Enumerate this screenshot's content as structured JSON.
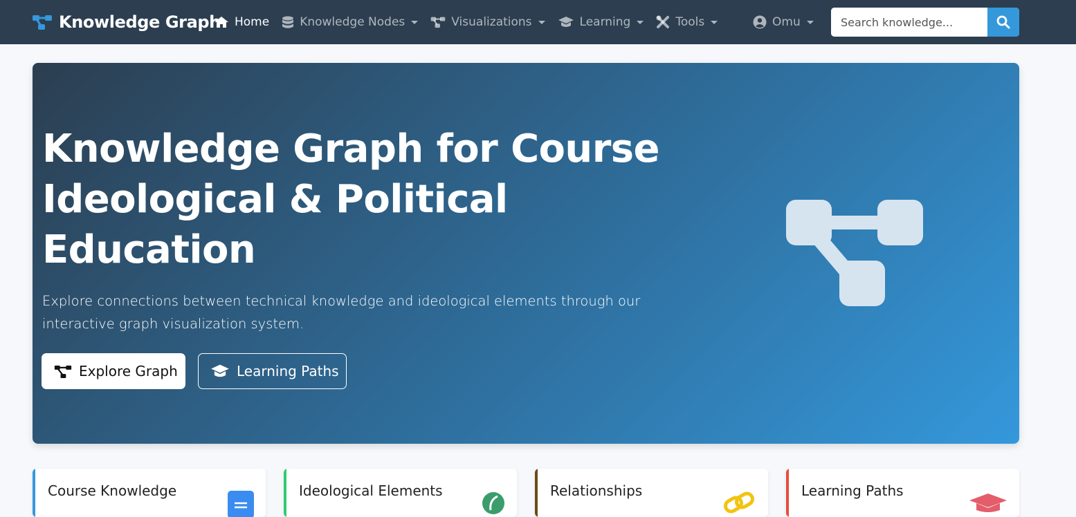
{
  "navbar": {
    "brand": "Knowledge Graph",
    "items": [
      {
        "label": "Home",
        "icon": "home-icon",
        "active": true
      },
      {
        "label": "Knowledge Nodes",
        "icon": "database-icon",
        "dropdown": true
      },
      {
        "label": "Visualizations",
        "icon": "project-diagram-icon",
        "dropdown": true
      },
      {
        "label": "Learning",
        "icon": "graduation-cap-icon",
        "dropdown": true
      },
      {
        "label": "Tools",
        "icon": "tools-icon",
        "dropdown": true
      }
    ],
    "user": "Omu",
    "search_placeholder": "Search knowledge..."
  },
  "hero": {
    "title": "Knowledge Graph for Course Ideological & Political Education",
    "subtitle": "Explore connections between technical knowledge and ideological elements through our interactive graph visualization system.",
    "primary_button": "Explore Graph",
    "secondary_button": "Learning Paths"
  },
  "cards": [
    {
      "title": "Course Knowledge",
      "accent": "#3498db",
      "icon": "book-icon"
    },
    {
      "title": "Ideological Elements",
      "accent": "#2ecc71",
      "icon": "leaf-icon"
    },
    {
      "title": "Relationships",
      "accent": "#6b4a16",
      "icon": "link-icon"
    },
    {
      "title": "Learning Paths",
      "accent": "#e74c3c",
      "icon": "graduation-cap-icon"
    }
  ],
  "colors": {
    "navbar": "#2c3e50",
    "accent": "#3498db",
    "hero_start": "#2c3e50",
    "hero_end": "#3498db"
  }
}
